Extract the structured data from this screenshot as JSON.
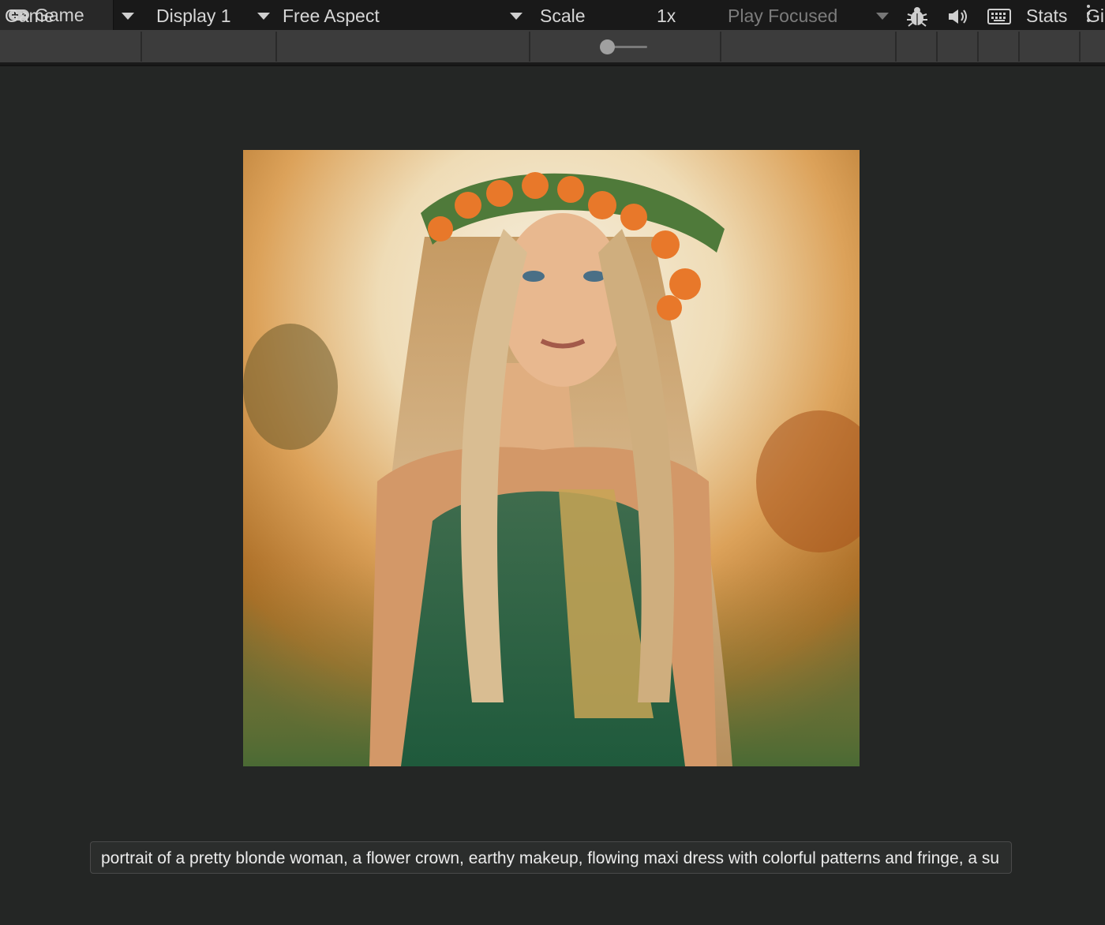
{
  "tab": {
    "title": "Game",
    "icon": "gamepad-icon"
  },
  "toolbar": {
    "view_mode": "Game",
    "display": "Display 1",
    "aspect": "Free Aspect",
    "scale_label": "Scale",
    "scale_value": "1x",
    "play_mode": "Play Focused",
    "stats_label": "Stats",
    "gizmos_label": "Gi",
    "icons": [
      "bug-icon",
      "speaker-icon",
      "keyboard-icon"
    ]
  },
  "viewport": {
    "image_alt": "portrait of a pretty blonde woman with a flower crown",
    "prompt_text": "portrait of a pretty blonde woman, a flower crown, earthy makeup, flowing maxi dress with colorful patterns and fringe, a su"
  },
  "colors": {
    "toolbar_bg": "#3c3c3c",
    "viewport_bg": "#242625",
    "tab_bg": "#282828"
  }
}
